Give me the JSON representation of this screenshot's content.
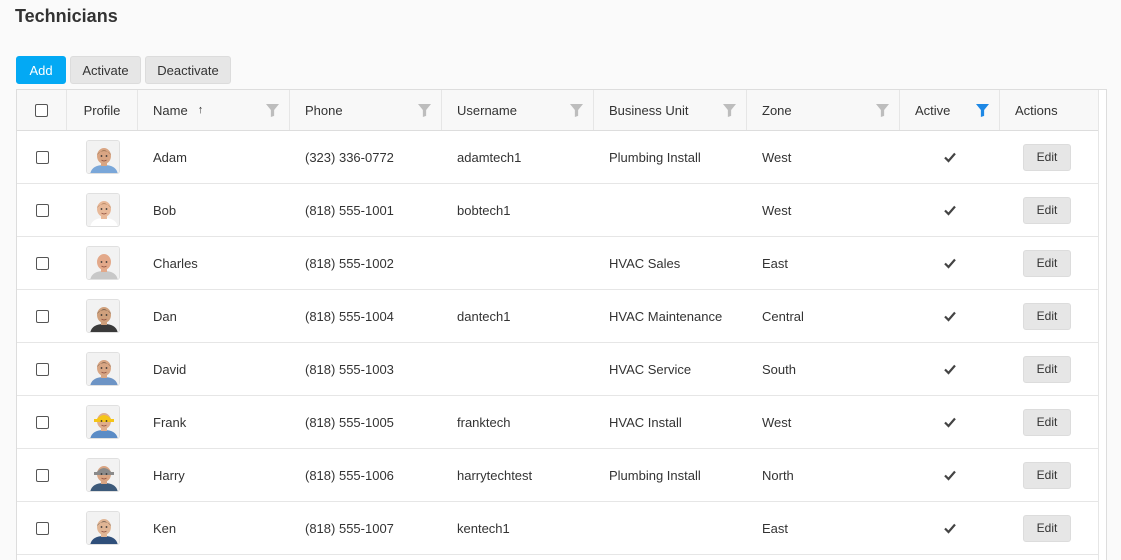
{
  "page": {
    "title": "Technicians"
  },
  "toolbar": {
    "add_label": "Add",
    "activate_label": "Activate",
    "deactivate_label": "Deactivate"
  },
  "grid": {
    "columns": {
      "profile": "Profile",
      "name": "Name",
      "phone": "Phone",
      "username": "Username",
      "business_unit": "Business Unit",
      "zone": "Zone",
      "active": "Active",
      "actions": "Actions"
    },
    "sort": {
      "column": "name",
      "direction": "ascending",
      "indicator": "↑"
    },
    "active_filter_color": "#1e88e5",
    "inactive_filter_color": "#bdbdbd",
    "edit_label": "Edit",
    "rows": [
      {
        "name": "Adam",
        "phone": "(323) 336-0772",
        "username": "adamtech1",
        "business_unit": "Plumbing Install",
        "zone": "West",
        "active": true,
        "avatar": {
          "skin": "#d9a583",
          "hair": "#6b4a2e",
          "shirt": "#7aa7d9",
          "hat": ""
        }
      },
      {
        "name": "Bob",
        "phone": "(818) 555-1001",
        "username": "bobtech1",
        "business_unit": "",
        "zone": "West",
        "active": true,
        "avatar": {
          "skin": "#e8b999",
          "hair": "#8c5a34",
          "shirt": "#ffffff",
          "hat": ""
        }
      },
      {
        "name": "Charles",
        "phone": "(818) 555-1002",
        "username": "",
        "business_unit": "HVAC Sales",
        "zone": "East",
        "active": true,
        "avatar": {
          "skin": "#e3a98a",
          "hair": "#e3a98a",
          "shirt": "#c8c8c8",
          "hat": ""
        }
      },
      {
        "name": "Dan",
        "phone": "(818) 555-1004",
        "username": "dantech1",
        "business_unit": "HVAC Maintenance",
        "zone": "Central",
        "active": true,
        "avatar": {
          "skin": "#cfa07c",
          "hair": "#2e2620",
          "shirt": "#3a3a3a",
          "hat": ""
        }
      },
      {
        "name": "David",
        "phone": "(818) 555-1003",
        "username": "",
        "business_unit": "HVAC Service",
        "zone": "South",
        "active": true,
        "avatar": {
          "skin": "#d8a684",
          "hair": "#3b2a1e",
          "shirt": "#6d94c5",
          "hat": ""
        }
      },
      {
        "name": "Frank",
        "phone": "(818) 555-1005",
        "username": "franktech",
        "business_unit": "HVAC Install",
        "zone": "West",
        "active": true,
        "avatar": {
          "skin": "#e0ad8c",
          "hair": "#e0ad8c",
          "shirt": "#5b8cc6",
          "hat": "#f5c518"
        }
      },
      {
        "name": "Harry",
        "phone": "(818) 555-1006",
        "username": "harrytechtest",
        "business_unit": "Plumbing Install",
        "zone": "North",
        "active": true,
        "avatar": {
          "skin": "#d9a583",
          "hair": "#6b4a2e",
          "shirt": "#3d5a7a",
          "hat": "#8a8a8a"
        }
      },
      {
        "name": "Ken",
        "phone": "(818) 555-1007",
        "username": "kentech1",
        "business_unit": "",
        "zone": "East",
        "active": true,
        "avatar": {
          "skin": "#e0b594",
          "hair": "#1c1c1c",
          "shirt": "#2f4f7a",
          "hat": ""
        }
      }
    ]
  }
}
